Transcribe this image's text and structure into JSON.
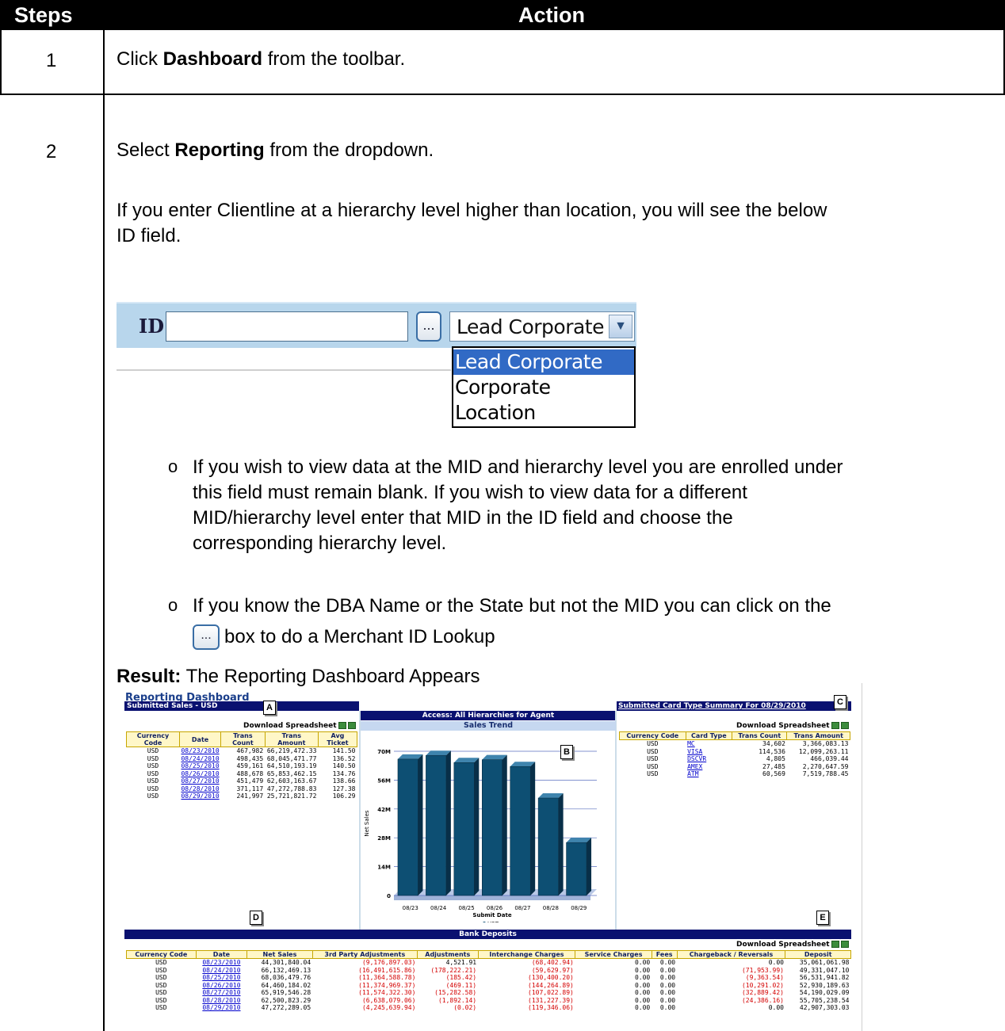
{
  "header": {
    "steps": "Steps",
    "action": "Action"
  },
  "step1": {
    "num": "1",
    "pre": "Click ",
    "bold": "Dashboard",
    "post": " from the toolbar."
  },
  "step2": {
    "num": "2",
    "pre": "Select ",
    "bold": "Reporting",
    "post": " from the dropdown.",
    "para_line1": "If you enter Clientline at a hierarchy level higher than location, you will see the below",
    "para_line2": "ID field.",
    "id_label": "ID",
    "lookup_glyph": "...",
    "select_value": "Lead Corporate",
    "dropdown_options": [
      "Lead Corporate",
      "Corporate",
      "Location"
    ],
    "bullet_glyph": "o",
    "bullet1": [
      "If you wish to view data at the MID and hierarchy level you are enrolled under",
      "this field must remain blank.  If you wish to view data for a different",
      "MID/hierarchy level enter that MID in the ID field and choose the",
      "corresponding hierarchy level."
    ],
    "bullet2_line1": "If you know the DBA Name or the State but not the MID you can click on the",
    "bullet2_line2": "box to do a Merchant ID Lookup",
    "result_bold": "Result:",
    "result_text": " The Reporting Dashboard Appears"
  },
  "dashboard": {
    "title": "Reporting Dashboard",
    "submitted_sales_bar": "Submitted Sales - USD",
    "access_bar": "Access: All Hierarchies for Agent",
    "card_summary_bar": "Submitted Card Type Summary For 08/29/2010",
    "sales_trend": "Sales Trend",
    "download": "Download Spreadsheet",
    "callouts": [
      "A",
      "B",
      "C",
      "D",
      "E"
    ],
    "sales_table": {
      "headers": [
        "Currency Code",
        "Date",
        "Trans Count",
        "Trans Amount",
        "Avg Ticket"
      ],
      "rows": [
        [
          "USD",
          "08/23/2010",
          "467,982",
          "66,219,472.33",
          "141.50"
        ],
        [
          "USD",
          "08/24/2010",
          "498,435",
          "68,045,471.77",
          "136.52"
        ],
        [
          "USD",
          "08/25/2010",
          "459,161",
          "64,510,193.19",
          "140.50"
        ],
        [
          "USD",
          "08/26/2010",
          "488,678",
          "65,853,462.15",
          "134.76"
        ],
        [
          "USD",
          "08/27/2010",
          "451,479",
          "62,603,163.67",
          "138.66"
        ],
        [
          "USD",
          "08/28/2010",
          "371,117",
          "47,272,788.83",
          "127.38"
        ],
        [
          "USD",
          "08/29/2010",
          "241,997",
          "25,721,821.72",
          "106.29"
        ]
      ]
    },
    "card_table": {
      "headers": [
        "Currency Code",
        "Card Type",
        "Trans Count",
        "Trans Amount"
      ],
      "rows": [
        [
          "USD",
          "MC",
          "34,602",
          "3,366,083.13"
        ],
        [
          "USD",
          "VISA",
          "114,536",
          "12,099,263.11"
        ],
        [
          "USD",
          "DSCVR",
          "4,805",
          "466,039.44"
        ],
        [
          "USD",
          "AMEX",
          "27,485",
          "2,270,647.59"
        ],
        [
          "USD",
          "ATM",
          "60,569",
          "7,519,788.45"
        ]
      ]
    },
    "bank_deposits_bar": "Bank Deposits",
    "deposits_table": {
      "headers": [
        "Currency Code",
        "Date",
        "Net Sales",
        "3rd Party Adjustments",
        "Adjustments",
        "Interchange Charges",
        "Service Charges",
        "Fees",
        "Chargeback / Reversals",
        "Deposit"
      ],
      "rows": [
        [
          "USD",
          "08/23/2010",
          "44,301,840.04",
          "(9,176,897.03)",
          "4,521.91",
          "(68,402.94)",
          "0.00",
          "0.00",
          "0.00",
          "35,061,061.98"
        ],
        [
          "USD",
          "08/24/2010",
          "66,132,469.13",
          "(16,491,615.86)",
          "(178,222.21)",
          "(59,629.97)",
          "0.00",
          "0.00",
          "(71,953.99)",
          "49,331,047.10"
        ],
        [
          "USD",
          "08/25/2010",
          "68,036,479.76",
          "(11,364,588.78)",
          "(185.42)",
          "(130,400.20)",
          "0.00",
          "0.00",
          "(9,363.54)",
          "56,531,941.82"
        ],
        [
          "USD",
          "08/26/2010",
          "64,460,184.02",
          "(11,374,969.37)",
          "(469.11)",
          "(144,264.89)",
          "0.00",
          "0.00",
          "(10,291.02)",
          "52,930,189.63"
        ],
        [
          "USD",
          "08/27/2010",
          "65,919,546.28",
          "(11,574,322.30)",
          "(15,282.58)",
          "(107,022.89)",
          "0.00",
          "0.00",
          "(32,889.42)",
          "54,190,029.09"
        ],
        [
          "USD",
          "08/28/2010",
          "62,500,823.29",
          "(6,638,079.06)",
          "(1,892.14)",
          "(131,227.39)",
          "0.00",
          "0.00",
          "(24,386.16)",
          "55,705,238.54"
        ],
        [
          "USD",
          "08/29/2010",
          "47,272,289.05",
          "(4,245,639.94)",
          "(0.02)",
          "(119,346.06)",
          "0.00",
          "0.00",
          "0.00",
          "42,907,303.03"
        ]
      ]
    }
  },
  "chart_data": {
    "type": "bar",
    "title": "Sales Trend",
    "xlabel": "Submit Date",
    "ylabel": "Net Sales",
    "categories": [
      "08/23",
      "08/24",
      "08/25",
      "08/26",
      "08/27",
      "08/28",
      "08/29"
    ],
    "series": [
      {
        "name": "USD",
        "values": [
          66.2,
          68.0,
          64.5,
          65.9,
          62.6,
          47.3,
          25.7
        ]
      }
    ],
    "yticks": [
      "0",
      "14M",
      "28M",
      "42M",
      "56M",
      "70M"
    ],
    "ylim": [
      0,
      70
    ],
    "bar_color": "#0d4f73",
    "grid": true
  }
}
